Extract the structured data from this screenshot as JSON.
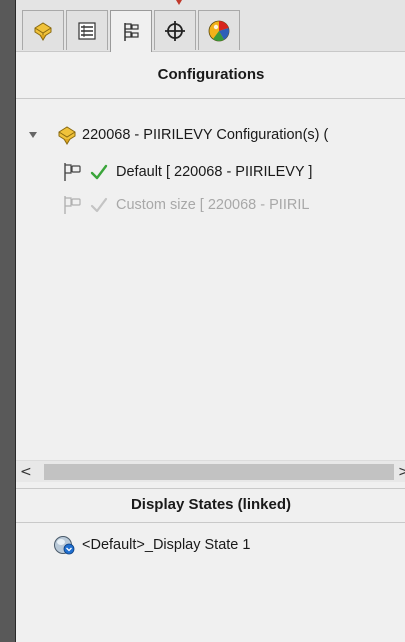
{
  "tabs": [
    {
      "name": "FeatureManager Design Tree",
      "icon": "part-icon",
      "active": false
    },
    {
      "name": "PropertyManager",
      "icon": "property-list-icon",
      "active": false
    },
    {
      "name": "ConfigurationManager",
      "icon": "configuration-manager-icon",
      "active": true
    },
    {
      "name": "DimXpertManager",
      "icon": "crosshair-icon",
      "active": false
    },
    {
      "name": "DisplayManager",
      "icon": "display-manager-icon",
      "active": false
    }
  ],
  "configurations": {
    "title": "Configurations",
    "root": {
      "label": "220068 - PIIRILEVY Configuration(s)  (",
      "expanded": true,
      "children": [
        {
          "label": "Default [ 220068 - PIIRILEVY ]",
          "active": true
        },
        {
          "label": "Custom size [ 220068 - PIIRIL",
          "active": false
        }
      ]
    }
  },
  "scrollbar": {
    "left_arrow": "<",
    "right_arrow": ">"
  },
  "display_states": {
    "title": "Display States (linked)",
    "items": [
      {
        "label": "<Default>_Display State 1",
        "icon": "display-state-icon"
      }
    ]
  },
  "colors": {
    "panel_bg": "#f0f0f0",
    "check_active": "#3aa53a",
    "check_inactive": "#b8b8b8",
    "part_icon": "#e8b923"
  }
}
